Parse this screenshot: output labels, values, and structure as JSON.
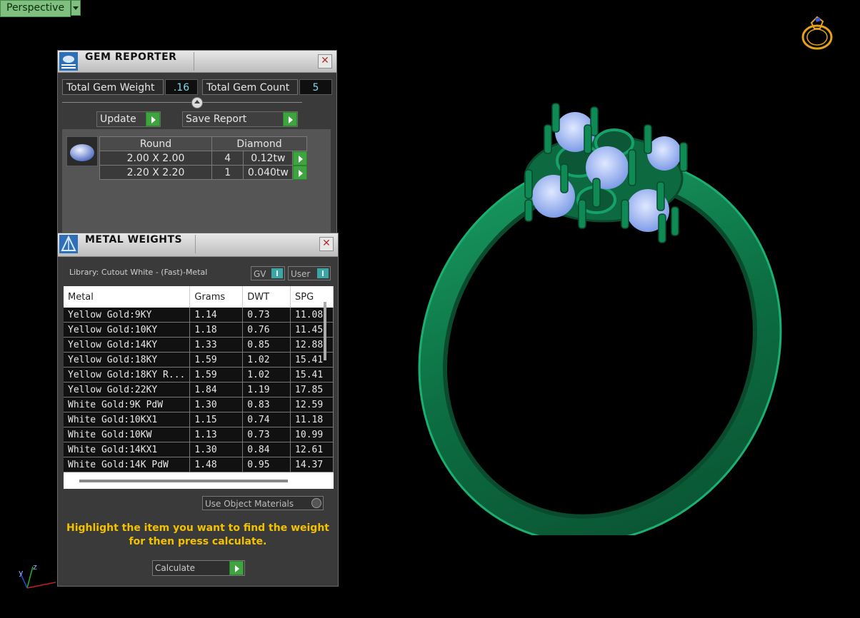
{
  "viewport": {
    "label": "Perspective"
  },
  "gem_reporter": {
    "title": "GEM REPORTER",
    "total_weight_label": "Total Gem Weight",
    "total_weight_value": ".16",
    "total_count_label": "Total Gem Count",
    "total_count_value": "5",
    "update_label": "Update",
    "save_report_label": "Save Report",
    "group": {
      "shape": "Round",
      "material": "Diamond",
      "rows": [
        {
          "size": "2.00 X 2.00",
          "count": "4",
          "weight": "0.12tw"
        },
        {
          "size": "2.20 X 2.20",
          "count": "1",
          "weight": "0.040tw"
        }
      ]
    }
  },
  "metal_weights": {
    "title": "METAL WEIGHTS",
    "library": "Library: Cutout White - (Fast)-Metal",
    "gv_label": "GV",
    "user_label": "User",
    "columns": [
      "Metal",
      "Grams",
      "DWT",
      "SPG"
    ],
    "rows": [
      [
        "Yellow Gold:9KY",
        "1.14",
        "0.73",
        "11.08"
      ],
      [
        "Yellow Gold:10KY",
        "1.18",
        "0.76",
        "11.45"
      ],
      [
        "Yellow Gold:14KY",
        "1.33",
        "0.85",
        "12.88"
      ],
      [
        "Yellow Gold:18KY",
        "1.59",
        "1.02",
        "15.41"
      ],
      [
        "Yellow Gold:18KY R...",
        "1.59",
        "1.02",
        "15.41"
      ],
      [
        "Yellow Gold:22KY",
        "1.84",
        "1.19",
        "17.85"
      ],
      [
        "White Gold:9K PdW",
        "1.30",
        "0.83",
        "12.59"
      ],
      [
        "White Gold:10KX1",
        "1.15",
        "0.74",
        "11.18"
      ],
      [
        "White Gold:10KW",
        "1.13",
        "0.73",
        "10.99"
      ],
      [
        "White Gold:14KX1",
        "1.30",
        "0.84",
        "12.61"
      ],
      [
        "White Gold:14K PdW",
        "1.48",
        "0.95",
        "14.37"
      ]
    ],
    "use_object_materials": "Use Object Materials",
    "hint": "Highlight the item you want to find the weight for then press calculate.",
    "calculate_label": "Calculate"
  },
  "axes": {
    "y": "y",
    "z": "z"
  },
  "colors": {
    "ring_green": "#0f7a48",
    "gem_blue": "#a9c2ff",
    "hint_yellow": "#f2c200"
  }
}
